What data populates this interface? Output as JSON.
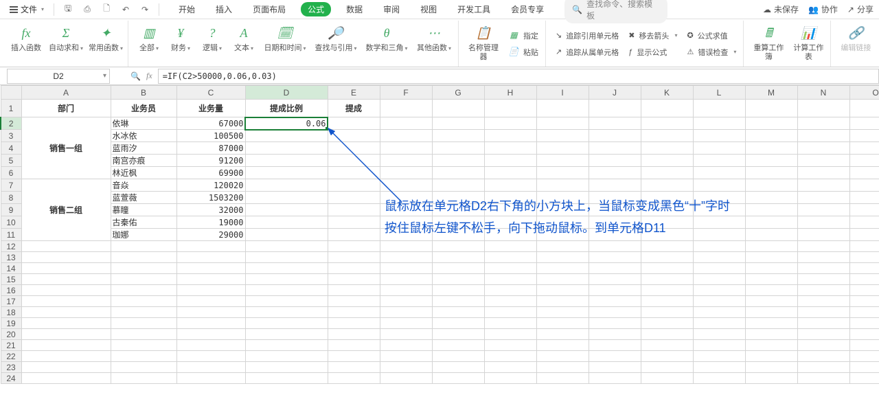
{
  "menu": {
    "file": "文件",
    "tabs": [
      "开始",
      "插入",
      "页面布局",
      "公式",
      "数据",
      "审阅",
      "视图",
      "开发工具",
      "会员专享"
    ],
    "active_tab_index": 3,
    "search_placeholder": "查找命令、搜索模板"
  },
  "right_menu": {
    "unsaved": "未保存",
    "collab": "协作",
    "share": "分享"
  },
  "ribbon": {
    "insert_fn": "插入函数",
    "autosum": "自动求和",
    "common": "常用函数",
    "all": "全部",
    "finance": "财务",
    "logic": "逻辑",
    "text": "文本",
    "datetime": "日期和时间",
    "lookup": "查找与引用",
    "math": "数学和三角",
    "other": "其他函数",
    "name_mgr": "名称管理器",
    "paste_group": "粘贴",
    "define": "指定",
    "trace_prec": "追踪引用单元格",
    "trace_dep": "追踪从属单元格",
    "remove_arrow": "移去箭头",
    "show_formula": "显示公式",
    "eval": "公式求值",
    "error_check": "错误检查",
    "recalc_book": "重算工作簿",
    "calc_sheet": "计算工作表",
    "edit_link": "编辑链接"
  },
  "fx": {
    "namebox": "D2",
    "formula": "=IF(C2>50000,0.06,0.03)"
  },
  "columns": [
    "A",
    "B",
    "C",
    "D",
    "E",
    "F",
    "G",
    "H",
    "I",
    "J",
    "K",
    "L",
    "M",
    "N",
    "O"
  ],
  "headers": {
    "A": "部门",
    "B": "业务员",
    "C": "业务量",
    "D": "提成比例",
    "E": "提成"
  },
  "merge_labels": {
    "group1": "销售一组",
    "group2": "销售二组"
  },
  "rows": [
    {
      "b": "依琳",
      "c": "67000",
      "d": "0.06"
    },
    {
      "b": "水冰依",
      "c": "100500"
    },
    {
      "b": "蓝雨汐",
      "c": "87000"
    },
    {
      "b": "南宫亦痕",
      "c": "91200"
    },
    {
      "b": "林近枫",
      "c": "69900"
    },
    {
      "b": "音焱",
      "c": "120020"
    },
    {
      "b": "蓝萱薇",
      "c": "1503200"
    },
    {
      "b": "慕瞳",
      "c": "32000"
    },
    {
      "b": "古秦佑",
      "c": "19000"
    },
    {
      "b": "珈娜",
      "c": "29000"
    }
  ],
  "annotation": {
    "line1": "鼠标放在单元格D2右下角的小方块上，当鼠标变成黑色“十”字时",
    "line2": "按住鼠标左键不松手，向下拖动鼠标。到单元格D11"
  }
}
